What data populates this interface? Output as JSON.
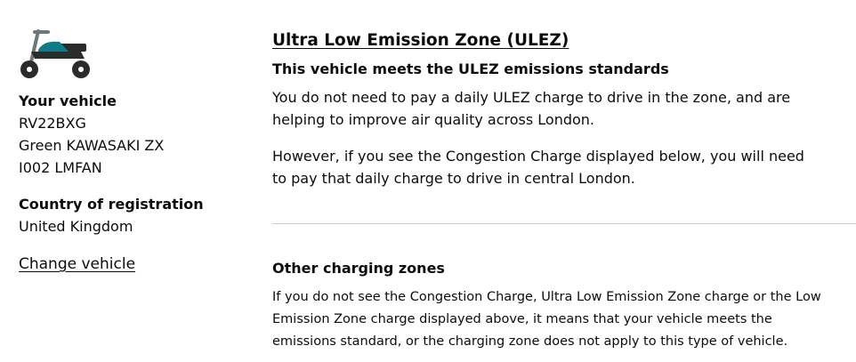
{
  "vehicle_panel": {
    "icon": "motorcycle-icon",
    "heading": "Your vehicle",
    "registration": "RV22BXG",
    "description": "Green KAWASAKI ZX",
    "model": "I002 LMFAN",
    "country_heading": "Country of registration",
    "country": "United Kingdom",
    "change_link": "Change vehicle"
  },
  "ulez": {
    "title": "Ultra Low Emission Zone (ULEZ)",
    "status": "This vehicle meets the ULEZ emissions standards",
    "para1": "You do not need to pay a daily ULEZ charge to drive in the zone, and are helping to improve air quality across London.",
    "para2": "However, if you see the Congestion Charge displayed below, you will need to pay that daily charge to drive in central London."
  },
  "other_zones": {
    "title": "Other charging zones",
    "text": "If you do not see the Congestion Charge, Ultra Low Emission Zone charge or the Low Emission Zone charge displayed above, it means that your vehicle meets the emissions standard, or the charging zone does not apply to this type of vehicle."
  },
  "colors": {
    "text": "#0b0c0c",
    "motorcycle_body": "#2b2b2b",
    "motorcycle_tank": "#0e7c86",
    "motorcycle_fork": "#6f777b",
    "divider": "#c8c8c8"
  }
}
